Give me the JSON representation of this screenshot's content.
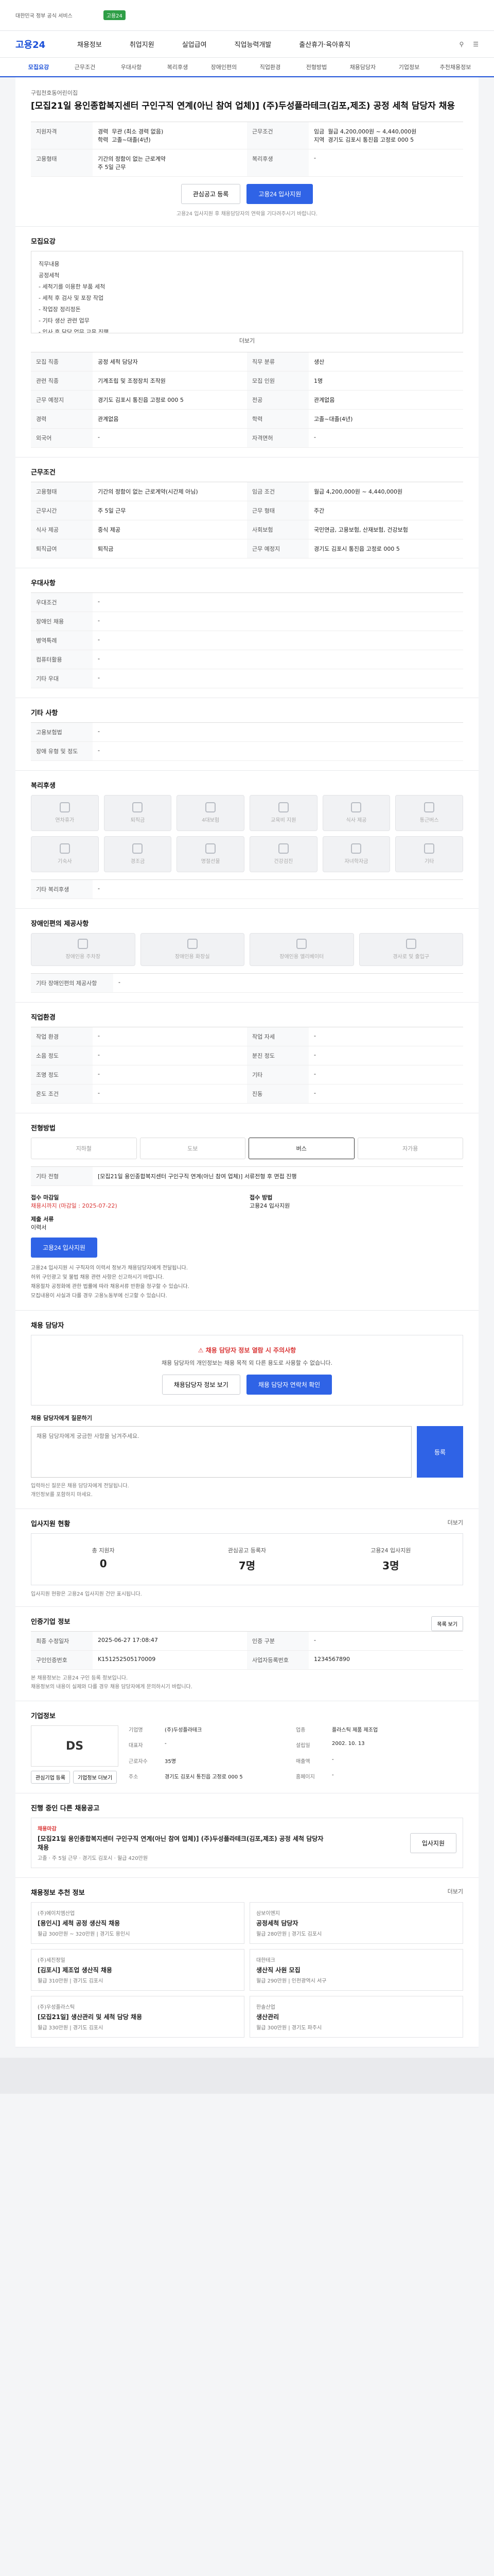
{
  "banner": {
    "gov_tag": "대한민국 정부 공식 서비스",
    "new_label": "고용24"
  },
  "gnb": {
    "logo": "고용24",
    "menu": [
      "채용정보",
      "취업지원",
      "실업급여",
      "직업능력개발",
      "출산휴가·육아휴직"
    ]
  },
  "tabs": [
    "모집요강",
    "근무조건",
    "우대사항",
    "복리후생",
    "장애인편의",
    "직업환경",
    "전형방법",
    "채용담당자",
    "기업정보",
    "추천채용정보"
  ],
  "header": {
    "org": "구립천호동어린이집",
    "title": "[모집21일 용인종합복지센터 구인구직 연계(아닌 참여 업체)] (주)두성플라테크(김포,제조) 공정 세척 담당자 채용",
    "summary": {
      "k1": "지원자격",
      "v1_a": "경력",
      "v1_b": "무관 (최소 경력 없음)",
      "v1_c": "학력",
      "v1_d": "고졸~대졸(4년)",
      "k2": "근무조건",
      "v2_a": "임금",
      "v2_b": "월급 4,200,000원 ~ 4,440,000원",
      "v2_c": "지역",
      "v2_d": "경기도 김포시 통진읍 고정로 000 5"
    },
    "k3": "고용형태",
    "v3_a": "기간의 정함이 없는 근로계약",
    "v3_b": "주 5일 근무",
    "k4": "복리후생",
    "v4": "-",
    "btn_scrap": "관심공고 등록",
    "btn_apply": "고용24 입사지원",
    "note": "고용24 입사지원 후 채용담당자의 연락을 기다려주시기 바랍니다."
  },
  "recruit": {
    "title": "모집요강",
    "job_title": "직무내용",
    "lines": [
      "공정세척",
      "- 세척기를 이용한 부품 세척",
      "- 세척 후 검사 및 포장 작업",
      "- 작업장 정리정돈",
      "- 기타 생산 관련 업무",
      "- 입사 후 담당 업무 교육 진행"
    ],
    "more": "더보기"
  },
  "detail_table": [
    [
      "모집 직종",
      "공정 세척 담당자",
      "직무 분류",
      "생산"
    ],
    [
      "관련 직종",
      "기계조립 및 조정장치 조작원",
      "모집 인원",
      "1명"
    ],
    [
      "근무 예정지",
      "경기도 김포시 통진읍 고정로 000 5",
      "전공",
      "관계없음"
    ],
    [
      "경력",
      "관계없음",
      "학력",
      "고졸~대졸(4년)"
    ],
    [
      "외국어",
      "-",
      "자격면허",
      "-"
    ]
  ],
  "work": {
    "title": "근무조건",
    "rows": [
      [
        "고용형태",
        "기간의 정함이 없는 근로계약(시간제 아님)",
        "임금 조건",
        "월급 4,200,000원 ~ 4,440,000원"
      ],
      [
        "근무시간",
        "주 5일 근무",
        "근무 형태",
        "주간"
      ],
      [
        "식사 제공",
        "중식 제공",
        "사회보험",
        "국민연금, 고용보험, 산재보험, 건강보험"
      ],
      [
        "퇴직급여",
        "퇴직금",
        "근무 예정지",
        "경기도 김포시 통진읍 고정로 000 5"
      ]
    ]
  },
  "pref": {
    "title": "우대사항",
    "rows": [
      [
        "우대조건",
        "-"
      ],
      [
        "장애인 채용",
        "-"
      ],
      [
        "병역특례",
        "-"
      ],
      [
        "컴퓨터활용",
        "-"
      ],
      [
        "기타 우대",
        "-"
      ]
    ]
  },
  "etc": {
    "title": "기타 사항",
    "rows": [
      [
        "고용보험법",
        "-"
      ],
      [
        "장애 유형 및 정도",
        "-"
      ]
    ]
  },
  "welfare": {
    "title": "복리후생",
    "items": [
      "연차휴가",
      "퇴직금",
      "4대보험",
      "교육비 지원",
      "식사 제공",
      "통근버스",
      "기숙사",
      "경조금",
      "명절선물",
      "건강검진",
      "자녀학자금",
      "기타"
    ],
    "note_k": "기타 복리후생",
    "note_v": "-"
  },
  "access": {
    "title": "장애인편의 제공사항",
    "items": [
      "장애인용 주차장",
      "장애인용 화장실",
      "장애인용 엘리베이터",
      "경사로 및 출입구"
    ],
    "note_k": "기타 장애인편의 제공사항",
    "note_v": "-"
  },
  "env": {
    "title": "직업환경",
    "rows": [
      [
        "작업 환경",
        "-",
        "작업 자세",
        "-"
      ],
      [
        "소음 정도",
        "-",
        "분진 정도",
        "-"
      ],
      [
        "조명 정도",
        "-",
        "기타",
        "-"
      ],
      [
        "온도 조건",
        "-",
        "진동",
        "-"
      ]
    ]
  },
  "selection": {
    "title": "전형방법",
    "trans": [
      "지하철",
      "도보",
      "버스",
      "자가용"
    ],
    "trans_active": 2,
    "desc_k": "기타 전형",
    "desc_v": "[모집21일 용인종합복지센터 구인구직 연계(아닌 참여 업체)] 서류전형 후 면접 진행",
    "apply_k": "접수 마감일",
    "apply_v": "채용시까지 (마감일 : 2025-07-22)",
    "method_k": "접수 방법",
    "method_v": "고용24 입사지원",
    "doc_k": "제출 서류",
    "doc_v": "이력서",
    "btn": "고용24 입사지원",
    "notice": [
      "고용24 입사지원 시 구직자의 이력서 정보가 채용담당자에게 전달됩니다.",
      "허위 구인광고 및 불법 채용 관련 사항은 신고하시기 바랍니다.",
      "채용절차 공정화에 관한 법률에 따라 채용서류 반환을 청구할 수 있습니다.",
      "모집내용이 사실과 다를 경우 고용노동부에 신고할 수 있습니다."
    ]
  },
  "manager": {
    "title": "채용 담당자",
    "alert_title": "채용 담당자 정보 열람 시 주의사항",
    "alert_text": "채용 담당자의 개인정보는 채용 목적 외 다른 용도로 사용할 수 없습니다.",
    "btn1": "채용담당자 정보 보기",
    "btn2": "채용 담당자 연락처 확인",
    "ask_title": "채용 담당자에게 질문하기",
    "ask_placeholder": "채용 담당자에게 궁금한 사항을 남겨주세요.",
    "ask_btn": "등록",
    "ask_notes": [
      "입력하신 질문은 채용 담당자에게 전달됩니다.",
      "개인정보를 포함하지 마세요."
    ]
  },
  "status": {
    "title": "입사지원 현황",
    "more": "더보기",
    "items": [
      {
        "label": "총 지원자",
        "value": "0"
      },
      {
        "label": "관심공고 등록자",
        "value": "7명"
      },
      {
        "label": "고용24 입사지원",
        "value": "3명"
      }
    ],
    "note": "입사지원 현황은 고용24 입사지원 건만 표시됩니다."
  },
  "job_info": {
    "title": "인증기업 정보",
    "btn": "목록 보기",
    "rows": [
      [
        "최종 수정일자",
        "2025-06-27 17:08:47",
        "인증 구분",
        "-"
      ],
      [
        "구인인증번호",
        "K151252505170009",
        "사업자등록번호",
        "1234567890"
      ]
    ],
    "notes": [
      "본 채용정보는 고용24 구인 등록 정보입니다.",
      "채용정보의 내용이 실제와 다를 경우 채용 담당자에게 문의하시기 바랍니다."
    ]
  },
  "company": {
    "title": "기업정보",
    "logo_text": "DS",
    "rows": [
      [
        "기업명",
        "(주)두성플라테크",
        "업종",
        "플라스틱 제품 제조업"
      ],
      [
        "대표자",
        "-",
        "설립일",
        "2002. 10. 13"
      ],
      [
        "근로자수",
        "35명",
        "매출액",
        "-"
      ],
      [
        "주소",
        "경기도 김포시 통진읍 고정로 000 5",
        "홈페이지",
        "-"
      ]
    ],
    "btn1": "관심기업 등록",
    "btn2": "기업정보 더보기"
  },
  "related": {
    "title": "진행 중인 다른 채용공고",
    "tag": "채용마감",
    "job": "[모집21일 용인종합복지센터 구인구직 연계(아닌 참여 업체)] (주)두성플라테크(김포,제조) 공정 세척 담당자 채용",
    "meta": [
      "고졸",
      "주 5일 근무",
      "경기도 김포시",
      "월급 420만원"
    ],
    "btn": "입사지원"
  },
  "recommend": {
    "title": "채용정보 추천 정보",
    "more": "더보기",
    "cards": [
      {
        "org": "(주)에이치엠산업",
        "title": "[용인시] 세척 공정 생산직 채용",
        "meta": "월급 300만원 ~ 320만원 | 경기도 용인시"
      },
      {
        "org": "삼보이엔지",
        "title": "공정세척 담당자",
        "meta": "월급 280만원 | 경기도 김포시"
      },
      {
        "org": "(주)세진정밀",
        "title": "[김포시] 제조업 생산직 채용",
        "meta": "월급 310만원 | 경기도 김포시"
      },
      {
        "org": "대한테크",
        "title": "생산직 사원 모집",
        "meta": "월급 290만원 | 인천광역시 서구"
      },
      {
        "org": "(주)우성플라스틱",
        "title": "[모집21일] 생산관리 및 세척 담당 채용",
        "meta": "월급 330만원 | 경기도 김포시"
      },
      {
        "org": "한솔산업",
        "title": "생산관리",
        "meta": "월급 300만원 | 경기도 파주시"
      }
    ]
  }
}
